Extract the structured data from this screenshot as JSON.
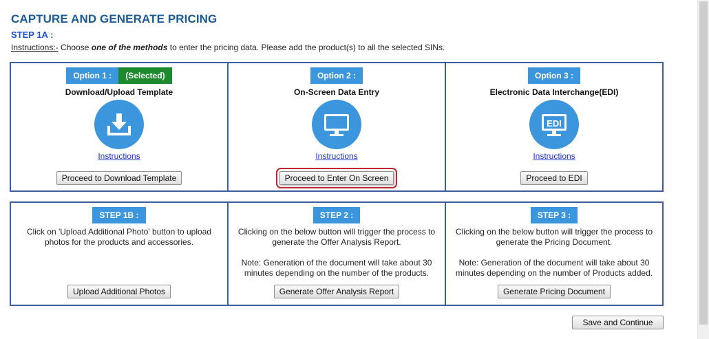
{
  "page": {
    "title": "CAPTURE AND GENERATE PRICING",
    "step_label": "STEP 1A :",
    "instructions_lead": "Instructions:-",
    "instructions_pre": " Choose ",
    "instructions_em": "one of the methods",
    "instructions_post": " to enter the pricing data. Please add the product(s) to all the selected SINs."
  },
  "options": [
    {
      "tag": "Option 1 :",
      "selected_tag": "(Selected)",
      "title": "Download/Upload Template",
      "icon": "download-icon",
      "instructions_link": "Instructions",
      "button": "Proceed to Download Template"
    },
    {
      "tag": "Option 2 :",
      "title": "On-Screen Data Entry",
      "icon": "monitor-icon",
      "instructions_link": "Instructions",
      "button": "Proceed to Enter On Screen"
    },
    {
      "tag": "Option 3 :",
      "title": "Electronic Data Interchange(EDI)",
      "icon": "edi-icon",
      "icon_text": "EDI",
      "instructions_link": "Instructions",
      "button": "Proceed to EDI"
    }
  ],
  "steps": [
    {
      "tag": "STEP 1B :",
      "description": "Click on 'Upload Additional Photo' button to upload photos for the products and accessories.",
      "button": "Upload Additional Photos"
    },
    {
      "tag": "STEP 2 :",
      "description": "Clicking on the below button will trigger the process to generate the Offer Analysis Report.",
      "note": "Note: Generation of the document will take about 30 minutes depending on the number of the products.",
      "button": "Generate Offer Analysis Report"
    },
    {
      "tag": "STEP 3 :",
      "description": "Clicking on the below button will trigger the process to generate the Pricing Document.",
      "note": "Note: Generation of the document will take about 30 minutes depending on the number of Products added.",
      "button": "Generate Pricing Document"
    }
  ],
  "footer": {
    "save_button": "Save and Continue"
  },
  "colors": {
    "title": "#1a5a96",
    "accent_blue": "#3b96dd",
    "selected_green": "#1e8a2e",
    "border": "#3d5e9e",
    "highlight_red": "#c0272d"
  }
}
